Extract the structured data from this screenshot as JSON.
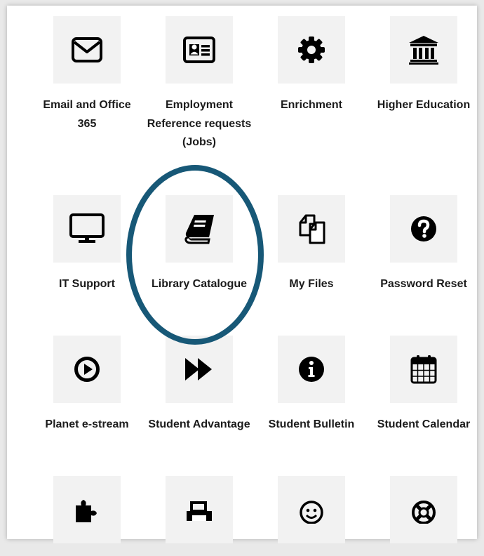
{
  "tiles": [
    {
      "label": "Email and Office 365",
      "icon": "envelope-icon"
    },
    {
      "label": "Employment Reference requests (Jobs)",
      "icon": "id-card-icon"
    },
    {
      "label": "Enrichment",
      "icon": "gear-icon"
    },
    {
      "label": "Higher Education",
      "icon": "university-icon"
    },
    {
      "label": "IT Support",
      "icon": "desktop-icon"
    },
    {
      "label": "Library Catalogue",
      "icon": "book-icon"
    },
    {
      "label": "My Files",
      "icon": "files-icon"
    },
    {
      "label": "Password Reset",
      "icon": "question-circle-icon"
    },
    {
      "label": "Planet e-stream",
      "icon": "play-circle-icon"
    },
    {
      "label": "Student Advantage",
      "icon": "fast-forward-icon"
    },
    {
      "label": "Student Bulletin",
      "icon": "info-circle-icon"
    },
    {
      "label": "Student Calendar",
      "icon": "calendar-icon"
    },
    {
      "label": "",
      "icon": "puzzle-piece-icon"
    },
    {
      "label": "",
      "icon": "printer-icon"
    },
    {
      "label": "",
      "icon": "smiley-icon"
    },
    {
      "label": "",
      "icon": "life-ring-icon"
    }
  ],
  "highlight": {
    "target": "Library Catalogue",
    "color": "#175877"
  }
}
